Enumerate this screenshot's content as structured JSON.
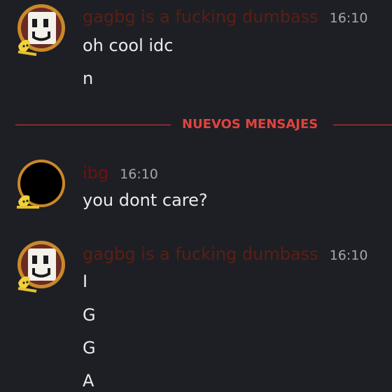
{
  "colors": {
    "background": "#1e1f24",
    "author_gagbg": "#5b1f14",
    "author_ibg": "#6e1010",
    "timestamp": "#a4a6ae",
    "message_text": "#e9eaee",
    "new_messages_divider": "#d13b3b"
  },
  "groups": [
    {
      "author": "gagbg is a fucking dumbass",
      "time": "16:10",
      "avatar_icon": "smiley-face-with-banana-avatar",
      "lines": [
        "oh cool idc",
        "n"
      ]
    },
    {
      "author": "ibg",
      "time": "16:10",
      "avatar_icon": "black-circle-with-banana-avatar",
      "lines": [
        "you dont care?"
      ]
    },
    {
      "author": "gagbg is a fucking dumbass",
      "time": "16:10",
      "avatar_icon": "smiley-face-with-banana-avatar",
      "lines": [
        "I",
        "G",
        "G",
        "A"
      ]
    }
  ],
  "divider": {
    "label": "NUEVOS MENSAJES"
  }
}
